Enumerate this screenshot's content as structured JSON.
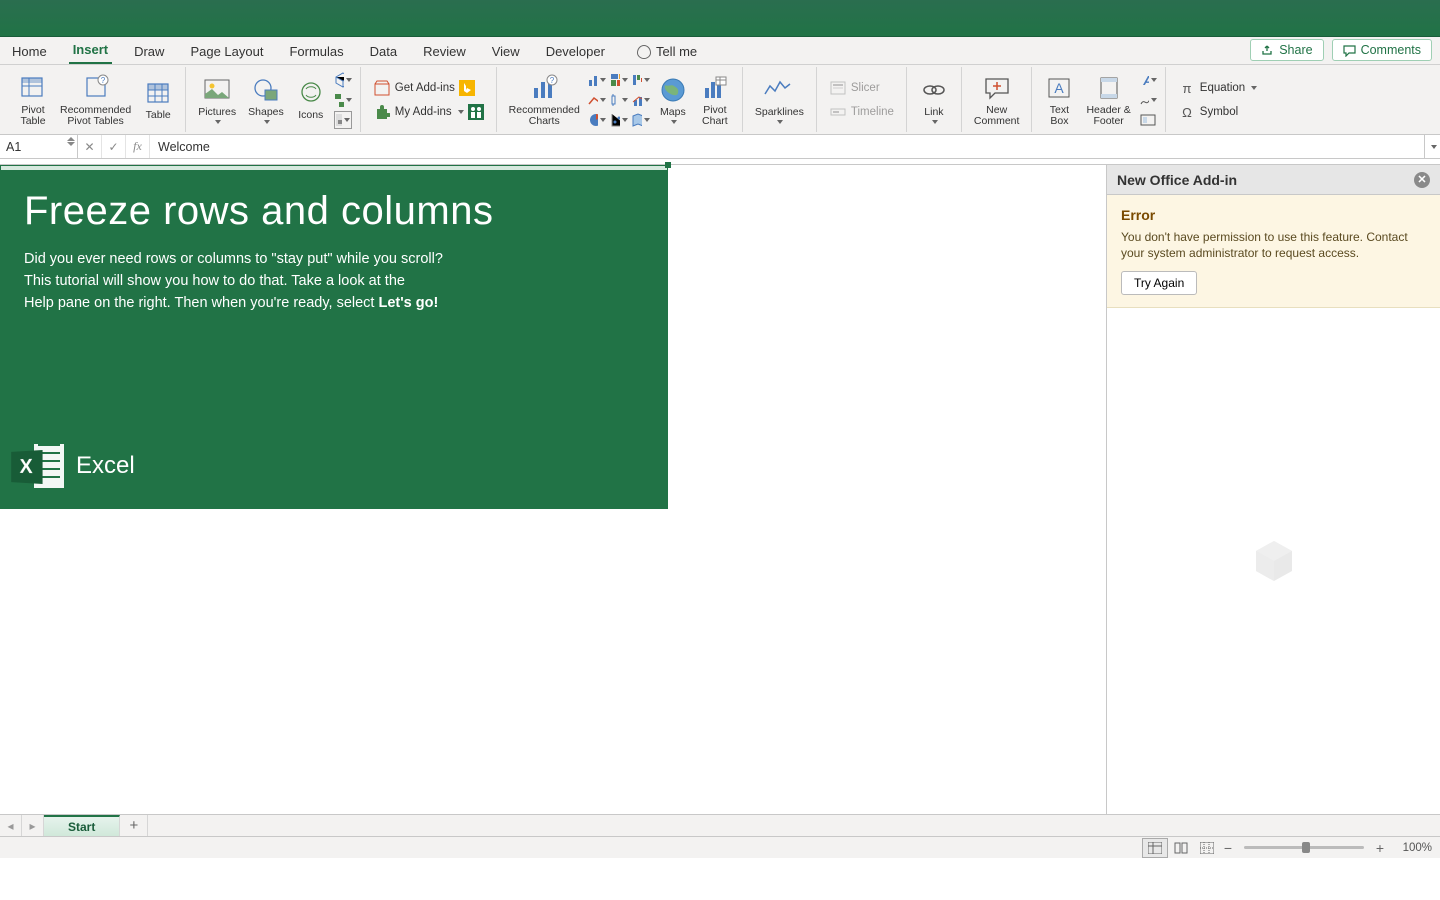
{
  "tabs": {
    "home": "Home",
    "insert": "Insert",
    "draw": "Draw",
    "page_layout": "Page Layout",
    "formulas": "Formulas",
    "data": "Data",
    "review": "Review",
    "view": "View",
    "developer": "Developer",
    "tell_me": "Tell me"
  },
  "top_right": {
    "share": "Share",
    "comments": "Comments"
  },
  "ribbon": {
    "pivot_table": "Pivot\nTable",
    "rec_pivot": "Recommended\nPivot Tables",
    "table": "Table",
    "pictures": "Pictures",
    "shapes": "Shapes",
    "icons": "Icons",
    "get_addins": "Get Add-ins",
    "my_addins": "My Add-ins",
    "rec_charts": "Recommended\nCharts",
    "maps": "Maps",
    "pivot_chart": "Pivot\nChart",
    "sparklines": "Sparklines",
    "slicer": "Slicer",
    "timeline": "Timeline",
    "link": "Link",
    "new_comment": "New\nComment",
    "text_box": "Text\nBox",
    "header_footer": "Header &\nFooter",
    "equation": "Equation",
    "symbol": "Symbol"
  },
  "namebox": {
    "cell": "A1",
    "formula": "Welcome"
  },
  "tutorial": {
    "title": "Freeze rows and columns",
    "line1": "Did you ever need rows or columns to \"stay put\" while you scroll?",
    "line2": "This tutorial will show you how to do that. Take a look at the",
    "line3_a": "Help pane on the right. Then when you're ready, select ",
    "line3_b": "Let's go!",
    "brand": "Excel"
  },
  "taskpane": {
    "title": "New Office Add-in",
    "error_title": "Error",
    "error_msg": "You don't have permission to use this feature. Contact your system administrator to request access.",
    "try_again": "Try Again"
  },
  "sheet_tabs": {
    "start": "Start"
  },
  "statusbar": {
    "zoom": "100%"
  }
}
